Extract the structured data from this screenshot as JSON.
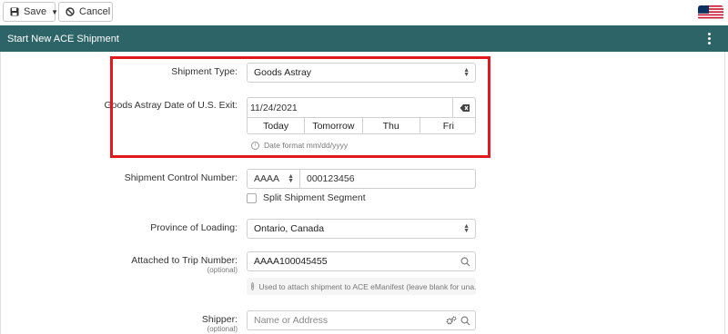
{
  "toolbar": {
    "save_label": "Save",
    "cancel_label": "Cancel",
    "flag_icon": "us-flag-icon"
  },
  "header": {
    "title": "Start New ACE Shipment",
    "menu_icon": "kebab-menu-icon"
  },
  "form": {
    "shipment_type": {
      "label": "Shipment Type:",
      "value": "Goods Astray"
    },
    "exit_date": {
      "label": "Goods Astray Date of U.S. Exit:",
      "value": "11/24/2021",
      "quick_options": [
        "Today",
        "Tomorrow",
        "Thu",
        "Fri"
      ],
      "hint": "Date format mm/dd/yyyy"
    },
    "shipment_control_number": {
      "label": "Shipment Control Number:",
      "prefix": "AAAA",
      "number": "000123456",
      "split_label": "Split Shipment Segment"
    },
    "province_of_loading": {
      "label": "Province of Loading:",
      "value": "Ontario, Canada"
    },
    "trip_number": {
      "label": "Attached to Trip Number:",
      "sub_label": "(optional)",
      "value": "AAAA100045455",
      "hint": "Used to attach shipment to ACE eManifest (leave blank for una..."
    },
    "shipper": {
      "label": "Shipper:",
      "sub_label": "(optional)",
      "placeholder": "Name or Address"
    }
  },
  "colors": {
    "header_bg": "#2d6467",
    "highlight_border": "#e01a1f"
  }
}
